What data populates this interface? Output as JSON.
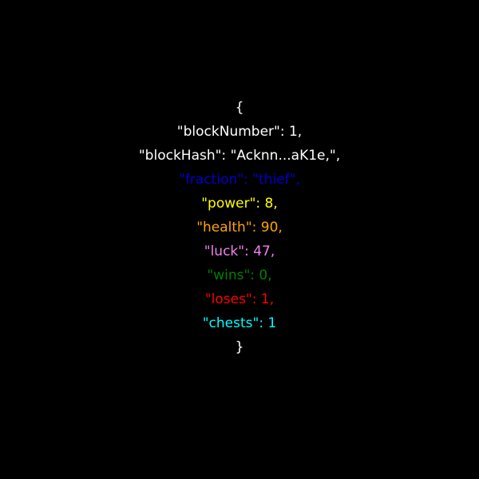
{
  "open_brace": "{",
  "close_brace": "}",
  "lines": [
    {
      "text": "\"blockNumber\": 1,",
      "color": "#ffffff"
    },
    {
      "text": "\"blockHash\": \"Acknn...aK1e,\",",
      "color": "#ffffff"
    },
    {
      "text": "\"fraction\": \"thief\",",
      "color": "#0000cc"
    },
    {
      "text": "\"power\": 8,",
      "color": "#ffff00"
    },
    {
      "text": "\"health\": 90,",
      "color": "#ffa500"
    },
    {
      "text": "\"luck\": 47,",
      "color": "#ee82ee"
    },
    {
      "text": "\"wins\": 0,",
      "color": "#008000"
    },
    {
      "text": "\"loses\": 1,",
      "color": "#ff0000"
    },
    {
      "text": "\"chests\": 1",
      "color": "#00ffff"
    }
  ],
  "brace_color": "#ffffff"
}
